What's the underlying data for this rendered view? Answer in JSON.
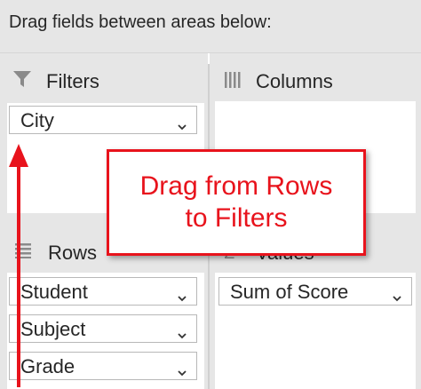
{
  "header": {
    "text": "Drag fields between areas below:"
  },
  "areas": {
    "filters": {
      "title": "Filters",
      "fields": [
        "City"
      ]
    },
    "columns": {
      "title": "Columns",
      "fields": []
    },
    "rows": {
      "title": "Rows",
      "fields": [
        "Student",
        "Subject",
        "Grade"
      ]
    },
    "values": {
      "title": "Values",
      "fields": [
        "Sum of Score"
      ]
    }
  },
  "callout": {
    "line1": "Drag from Rows",
    "line2": "to Filters"
  },
  "colors": {
    "accent": "#e8131c",
    "panel": "#e6e6e6",
    "field_border": "#b8b8b8"
  },
  "icons": [
    "filter-icon",
    "columns-icon",
    "rows-icon",
    "chevron-down-icon"
  ]
}
